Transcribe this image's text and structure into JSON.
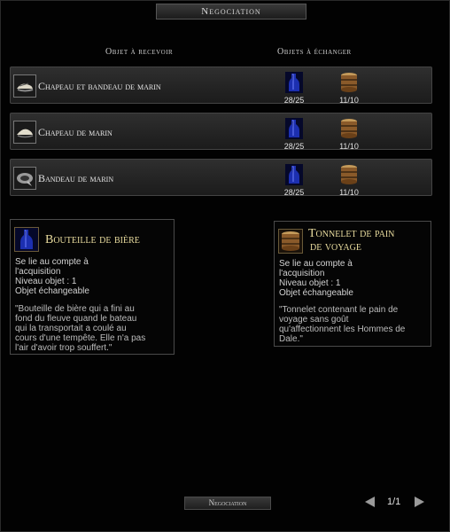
{
  "window": {
    "title": "Negociation"
  },
  "columns": {
    "receive": "Objet à recevoir",
    "exchange": "Objets à échanger"
  },
  "rows": [
    {
      "label": "Chapeau et bandeau de marin",
      "icon": "hat-and-bandana-icon",
      "costs": [
        {
          "item": "bottle",
          "count": "28/25"
        },
        {
          "item": "barrel",
          "count": "11/10"
        }
      ]
    },
    {
      "label": "Chapeau de marin",
      "icon": "sailor-hat-icon",
      "costs": [
        {
          "item": "bottle",
          "count": "28/25"
        },
        {
          "item": "barrel",
          "count": "11/10"
        }
      ]
    },
    {
      "label": "Bandeau de marin",
      "icon": "bandana-icon",
      "costs": [
        {
          "item": "bottle",
          "count": "28/25"
        },
        {
          "item": "barrel",
          "count": "11/10"
        }
      ]
    }
  ],
  "tooltips": [
    {
      "title": "Bouteille de bière",
      "icon": "beer-bottle-icon",
      "lines": [
        "Se lie au compte à",
        "l'acquisition",
        "Niveau objet : 1",
        "Objet échangeable"
      ],
      "description": [
        "\"Bouteille de bière qui a fini au",
        "fond du fleuve quand le bateau",
        "qui la transportait a coulé au",
        "cours d'une tempête. Elle n'a pas",
        "l'air d'avoir trop souffert.\""
      ]
    },
    {
      "title": [
        "Tonnelet de pain",
        "de voyage"
      ],
      "icon": "bread-barrel-icon",
      "lines": [
        "Se lie au compte à",
        "l'acquisition",
        "Niveau objet : 1",
        "Objet échangeable"
      ],
      "description": [
        "\"Tonnelet contenant le pain de",
        "voyage sans goût",
        "qu'affectionnent les Hommes de",
        "Dale.\""
      ]
    }
  ],
  "footer": {
    "tab_label": "Negociation",
    "page": "1/1"
  },
  "colors": {
    "title_gold": "#e9dc9e",
    "row_bg": "#2a2a2a"
  }
}
